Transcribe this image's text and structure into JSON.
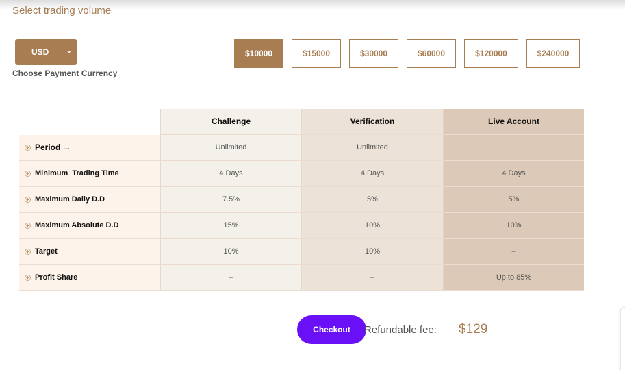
{
  "header": {
    "title": "Select trading volume"
  },
  "currency": {
    "selected": "USD",
    "label": "Choose Payment Currency",
    "chevron_icon": "chevron-down-icon"
  },
  "volumes": [
    {
      "label": "$10000",
      "active": true
    },
    {
      "label": "$15000",
      "active": false
    },
    {
      "label": "$30000",
      "active": false
    },
    {
      "label": "$60000",
      "active": false
    },
    {
      "label": "$120000",
      "active": false
    },
    {
      "label": "$240000",
      "active": false
    }
  ],
  "table": {
    "columns": [
      "Challenge",
      "Verification",
      "Live Account"
    ],
    "rows": [
      {
        "label": "Period →",
        "values": [
          "Unlimited",
          "Unlimited",
          ""
        ]
      },
      {
        "label": "Minimum  Trading Time",
        "values": [
          "4 Days",
          "4 Days",
          "4 Days"
        ]
      },
      {
        "label": "Maximum Daily D.D",
        "values": [
          "7.5%",
          "5%",
          "5%"
        ]
      },
      {
        "label": "Maximum Absolute D.D",
        "values": [
          "15%",
          "10%",
          "10%"
        ]
      },
      {
        "label": "Target",
        "values": [
          "10%",
          "10%",
          "–"
        ]
      },
      {
        "label": "Profit Share",
        "values": [
          "–",
          "–",
          "Up to 85%"
        ]
      }
    ]
  },
  "checkout": {
    "button_label": "Checkout",
    "fee_label": "Refundable fee:",
    "fee_value": "$129"
  },
  "colors": {
    "brand": "#a87d52",
    "checkout": "#6a10f6"
  }
}
